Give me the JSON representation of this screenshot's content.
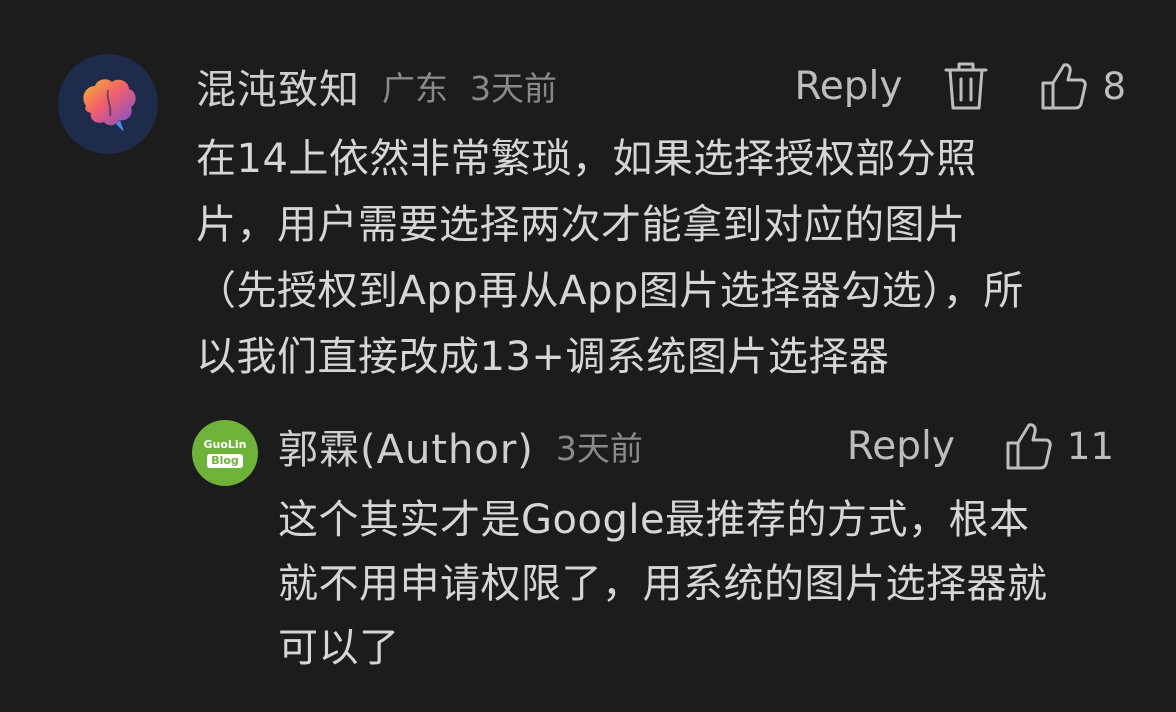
{
  "comment": {
    "username": "混沌致知",
    "location": "广东",
    "time": "3天前",
    "reply_label": "Reply",
    "like_count": "8",
    "text": "在14上依然非常繁琐，如果选择授权部分照\n片，用户需要选择两次才能拿到对应的图片\n（先授权到App再从App图片选择器勾选），所\n以我们直接改成13+调系统图片选择器",
    "icons": {
      "avatar": "brain-avatar-icon",
      "delete": "trash-icon",
      "like": "thumbs-up-icon"
    }
  },
  "reply": {
    "username": "郭霖(Author)",
    "time": "3天前",
    "reply_label": "Reply",
    "like_count": "11",
    "avatar_top": "GuoLin",
    "avatar_bottom": "Blog",
    "text": "这个其实才是Google最推荐的方式，根本\n就不用申请权限了，用系统的图片选择器就\n可以了",
    "icons": {
      "like": "thumbs-up-icon"
    }
  },
  "colors": {
    "background": "#1c1c1c",
    "text": "#d6d6d6",
    "meta": "#8a8a8a",
    "avatar_green": "#6fb23a"
  }
}
